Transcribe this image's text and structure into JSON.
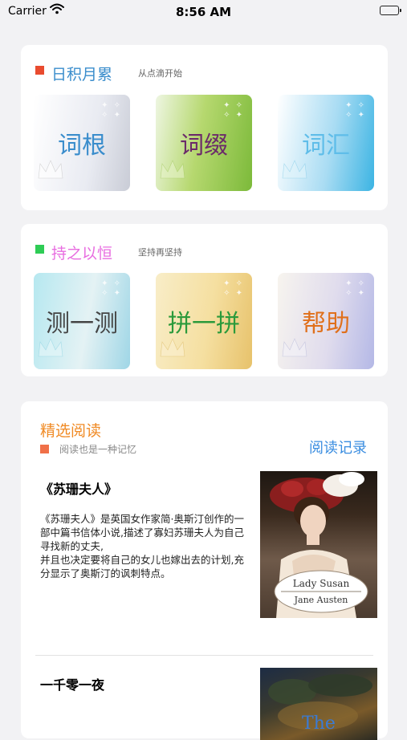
{
  "status_bar": {
    "carrier": "Carrier",
    "time": "8:56 AM"
  },
  "colors": {
    "accent_red": "#e94b2f",
    "accent_green": "#2ecc55",
    "accent_orange": "#f08a24",
    "link_blue": "#3a8de0"
  },
  "section1": {
    "title": "日积月累",
    "subtitle": "从点滴开始",
    "title_color": "#3a8dcc",
    "tiles": [
      {
        "label": "词根"
      },
      {
        "label": "词缀"
      },
      {
        "label": "词汇"
      }
    ]
  },
  "section2": {
    "title": "持之以恒",
    "subtitle": "坚持再坚持",
    "title_color": "#e86de0",
    "tiles": [
      {
        "label": "测一测"
      },
      {
        "label": "拼一拼"
      },
      {
        "label": "帮助"
      }
    ]
  },
  "reading": {
    "title": "精选阅读",
    "subtitle": "阅读也是一种记忆",
    "history_link": "阅读记录",
    "books": [
      {
        "title": "《苏珊夫人》",
        "description": "《苏珊夫人》是英国女作家简·奥斯汀创作的一部中篇书信体小说,描述了寡妇苏珊夫人为自己寻找新的丈夫,\n并且也决定要将自己的女儿也嫁出去的计划,充分显示了奥斯汀的讽刺特点。",
        "cover_line1": "Lady Susan",
        "cover_line2": "Jane Austen"
      },
      {
        "title": "一千零一夜",
        "cover_text": "The"
      }
    ]
  }
}
